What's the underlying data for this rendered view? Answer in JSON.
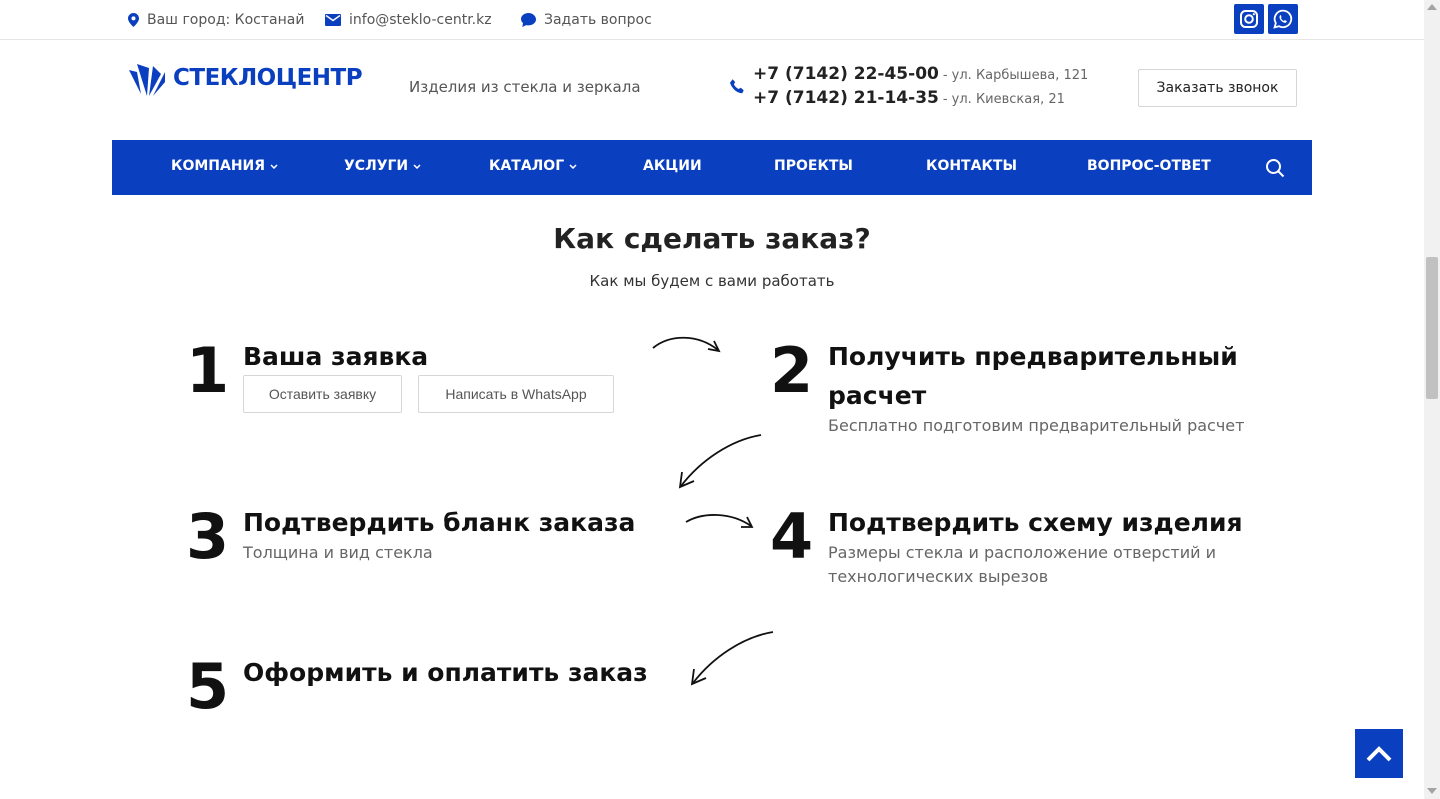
{
  "colors": {
    "brand": "#0a3fbf",
    "text": "#222222",
    "muted": "#666666"
  },
  "topbar": {
    "city": "Ваш город: Костанай",
    "email": "info@steklo-centr.kz",
    "ask": "Задать вопрос",
    "social": [
      "instagram-icon",
      "whatsapp-icon"
    ]
  },
  "header": {
    "logo": "СТЕКЛОЦЕНТР",
    "tagline": "Изделия из стекла и зеркала",
    "phones": [
      {
        "number": "+7 (7142) 22-45-00",
        "address": "- ул. Карбышева, 121"
      },
      {
        "number": "+7 (7142) 21-14-35",
        "address": "- ул. Киевская, 21"
      }
    ],
    "callback_label": "Заказать звонок"
  },
  "nav": {
    "items": [
      {
        "label": "КОМПАНИЯ",
        "dropdown": true
      },
      {
        "label": "УСЛУГИ",
        "dropdown": true
      },
      {
        "label": "КАТАЛОГ",
        "dropdown": true
      },
      {
        "label": "АКЦИИ",
        "dropdown": false
      },
      {
        "label": "ПРОЕКТЫ",
        "dropdown": false
      },
      {
        "label": "КОНТАКТЫ",
        "dropdown": false
      },
      {
        "label": "ВОПРОС-ОТВЕТ",
        "dropdown": false
      }
    ],
    "search_icon": "search-icon"
  },
  "section": {
    "title": "Как сделать заказ?",
    "subtitle": "Как мы будем с вами работать",
    "steps": [
      {
        "num": "1",
        "title": "Ваша заявка",
        "buttons": [
          "Оставить заявку",
          "Написать в WhatsApp"
        ]
      },
      {
        "num": "2",
        "title_line1": "Получить предварительный",
        "title_line2": "расчет",
        "text": "Бесплатно подготовим предварительный расчет"
      },
      {
        "num": "3",
        "title": "Подтвердить бланк заказа",
        "text": "Толщина и вид стекла"
      },
      {
        "num": "4",
        "title": "Подтвердить схему изделия",
        "text_line1": "Размеры стекла и расположение отверстий и",
        "text_line2": "технологических вырезов"
      },
      {
        "num": "5",
        "title": "Оформить и оплатить заказ"
      }
    ]
  }
}
